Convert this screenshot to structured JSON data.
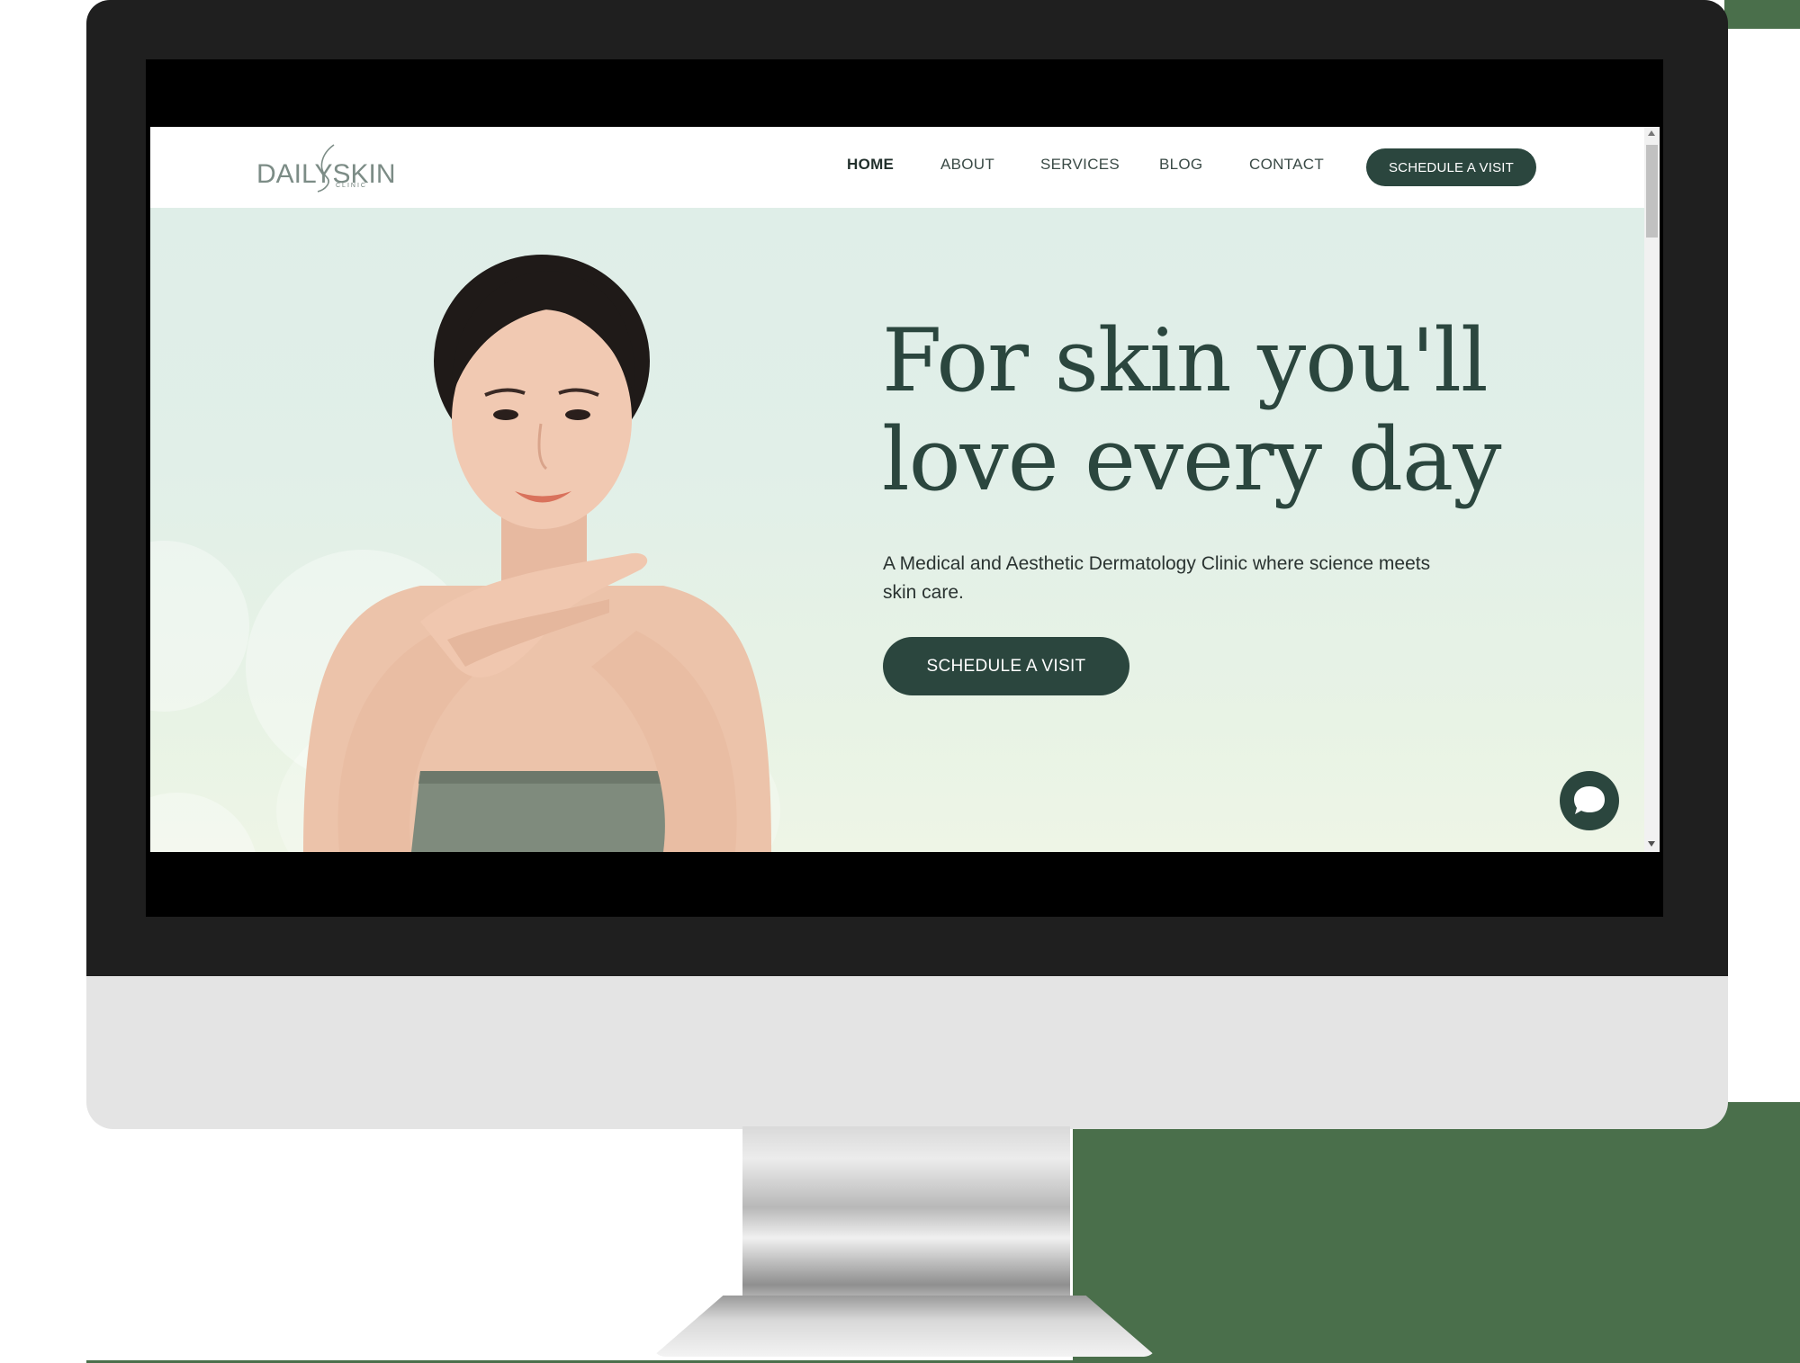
{
  "site": {
    "logo": {
      "text": "DAILYSKIN",
      "sub": "CLINIC"
    },
    "nav": {
      "items": [
        {
          "label": "HOME",
          "active": true
        },
        {
          "label": "ABOUT",
          "active": false
        },
        {
          "label": "SERVICES",
          "active": false
        },
        {
          "label": "BLOG",
          "active": false
        },
        {
          "label": "CONTACT",
          "active": false
        }
      ],
      "cta_label": "SCHEDULE A VISIT"
    },
    "hero": {
      "title_line1": "For skin you'll",
      "title_line2": "love every day",
      "subtitle": "A Medical and Aesthetic Dermatology Clinic where science meets skin care.",
      "cta_label": "SCHEDULE A VISIT",
      "image_alt": "Smiling woman resting her chin on her hands"
    },
    "chat": {
      "icon": "chat-bubble-icon"
    }
  },
  "colors": {
    "accent": "#2b463e",
    "hero_bg": "#e1efe8",
    "bezel": "#1f1f1f",
    "chin": "#e4e4e4"
  }
}
